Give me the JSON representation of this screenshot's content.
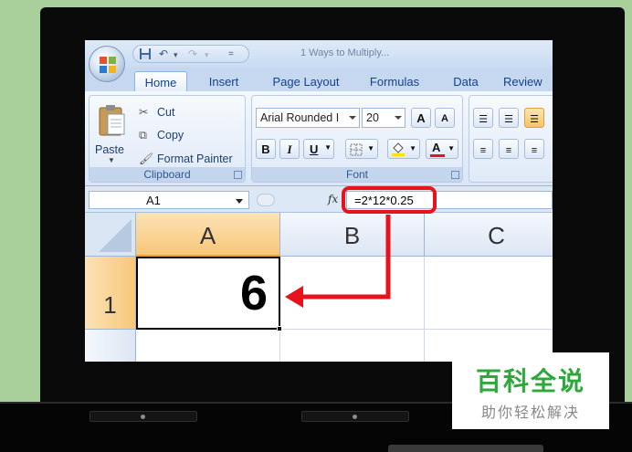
{
  "quick_access": {
    "save_icon": "save-icon",
    "undo_icon": "undo-icon",
    "redo_icon": "redo-icon",
    "doc_title": "1 Ways to Multiply..."
  },
  "tabs": [
    {
      "label": "Home",
      "active": true
    },
    {
      "label": "Insert"
    },
    {
      "label": "Page Layout"
    },
    {
      "label": "Formulas"
    },
    {
      "label": "Data"
    },
    {
      "label": "Review"
    }
  ],
  "clipboard": {
    "paste_label": "Paste",
    "cut_label": "Cut",
    "copy_label": "Copy",
    "format_painter_label": "Format Painter",
    "group_label": "Clipboard"
  },
  "font": {
    "font_name": "Arial Rounded I",
    "font_size": "20",
    "bold": "B",
    "italic": "I",
    "underline": "U",
    "grow": "A",
    "shrink": "A",
    "font_color_letter": "A",
    "group_label": "Font"
  },
  "formula_bar": {
    "name_box": "A1",
    "fx_label": "fx",
    "formula": "=2*12*0.25"
  },
  "grid": {
    "columns": [
      "A",
      "B",
      "C"
    ],
    "rows": [
      "1"
    ],
    "cell_a1_value": "6"
  },
  "watermark": {
    "title": "百科全说",
    "subtitle": "助你轻松解决"
  },
  "colors": {
    "highlight_red": "#e8121c",
    "selected_header": "#f8c77a",
    "watermark_green": "#2ea83a"
  }
}
